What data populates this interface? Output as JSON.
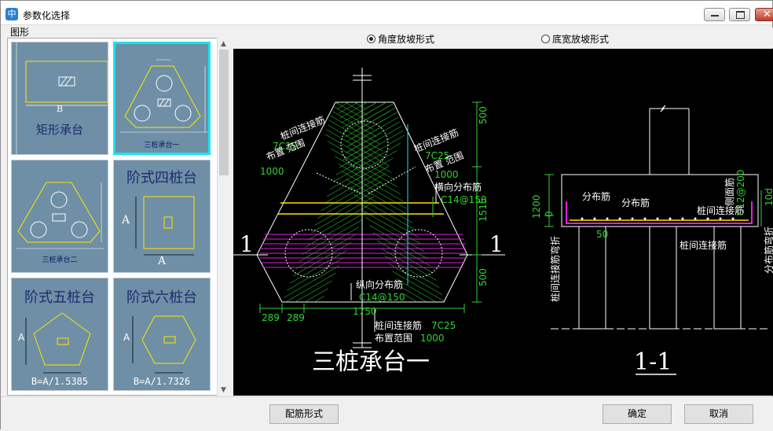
{
  "window": {
    "title": "参数化选择"
  },
  "gallery": {
    "group_label": "图形",
    "items": [
      {
        "label": "矩形承台",
        "dim": "B"
      },
      {
        "label": "三桩承台一",
        "selected": true
      },
      {
        "label": "三桩承台二"
      },
      {
        "label": "阶式四桩台",
        "dim_a": "A"
      },
      {
        "label": "阶式五桩台",
        "dim_a": "A",
        "formula": "B=A/1.5385"
      },
      {
        "label": "阶式六桩台",
        "dim_a": "A",
        "formula": "B=A/1.7326"
      }
    ]
  },
  "options": {
    "radio_angle": "角度放坡形式",
    "radio_width": "底宽放坡形式"
  },
  "drawing": {
    "plan": {
      "title": "三桩承台一",
      "section_mark": "1",
      "label_link_left_1": "桩间连接筋",
      "label_link_left_2": "7C25",
      "label_range_left_1": "布置 范围",
      "label_range_left_2": "1000",
      "label_link_right_1": "桩间连接筋",
      "label_link_right_2": "7C25",
      "label_range_right_1": "布置 范围",
      "label_range_right_2": "1000",
      "label_trans_1": "横向分布筋",
      "label_trans_2": "C14@150",
      "label_long_1": "纵向分布筋",
      "label_long_2": "C14@150",
      "label_bot_link_1": "桩间连接筋",
      "label_bot_link_2": "7C25",
      "label_bot_range_1": "布置范围",
      "label_bot_range_2": "1000",
      "dim_500_top": "500",
      "dim_1515": "1515",
      "dim_500_bot": "500",
      "dim_289_a": "289",
      "dim_289_b": "289",
      "dim_1750": "1750"
    },
    "section": {
      "title": "1-1",
      "label_dist_1": "分布筋",
      "label_dist_2": "分布筋",
      "label_link": "桩间连接筋",
      "label_link_bottom": "桩间连接筋",
      "label_side": "侧面筋",
      "label_side_spec": "C12@200",
      "label_left_vert": "桩间连接筋弯折",
      "label_right_vert": "分布筋弯折",
      "dim_1200": "1200",
      "dim_0": "0",
      "dim_50": "50",
      "dim_right": "10d"
    }
  },
  "footer": {
    "rebar_form": "配筋形式",
    "ok": "确定",
    "cancel": "取消"
  },
  "colors": {
    "selected_border": "#19e3f0",
    "thumb_bg": "#6e8fa6",
    "canvas_bg": "#000000",
    "dim_green": "#2fd42f",
    "rebar_magenta": "#e020e0"
  }
}
